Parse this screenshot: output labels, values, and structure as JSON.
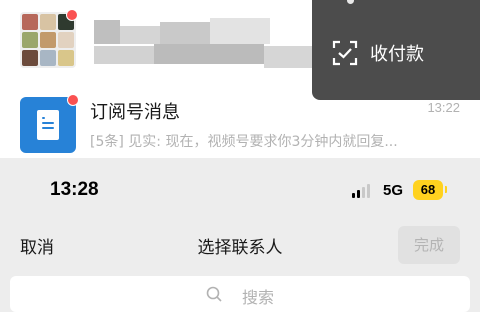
{
  "chat_list": {
    "row1": {
      "avatar": "group-avatar",
      "badge_color": "#fa5151"
    },
    "row2": {
      "avatar": "doc-icon",
      "title": "订阅号消息",
      "time": "13:22",
      "preview": "[5条] 见实: 现在，视频号要求你3分钟内就回复..."
    }
  },
  "popup_menu": {
    "items": [
      {
        "icon": "scan-pay-icon",
        "label": "收付款"
      }
    ]
  },
  "status_bar": {
    "time": "13:28",
    "network": "5G",
    "battery": "68",
    "battery_color": "#ffd21f"
  },
  "contact_picker": {
    "cancel_label": "取消",
    "title": "选择联系人",
    "done_label": "完成",
    "search_placeholder": "搜索"
  }
}
